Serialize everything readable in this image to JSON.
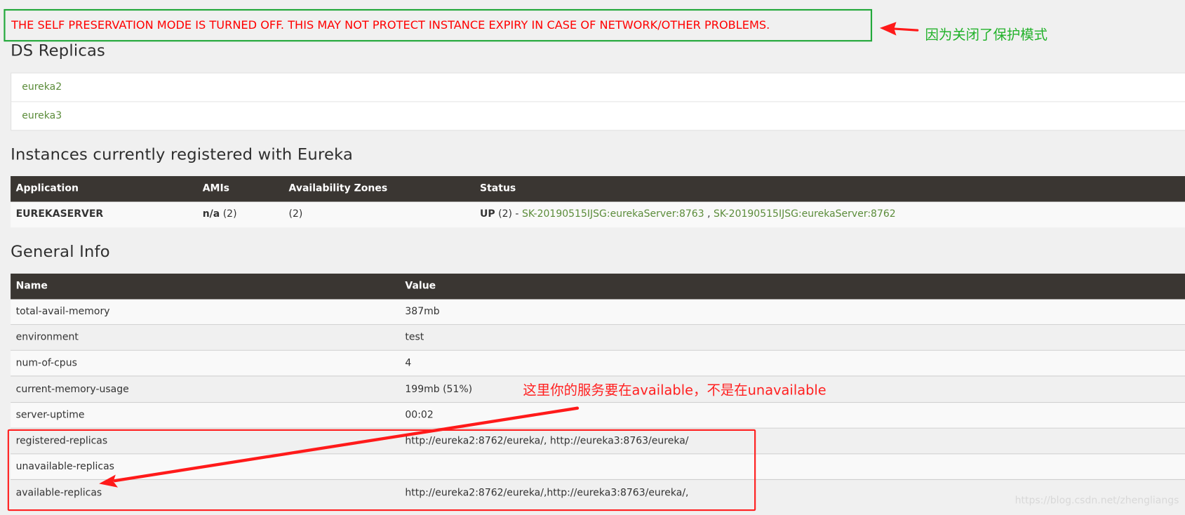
{
  "warning": {
    "text": "THE SELF PRESERVATION MODE IS TURNED OFF. THIS MAY NOT PROTECT INSTANCE EXPIRY IN CASE OF NETWORK/OTHER PROBLEMS."
  },
  "annotations": {
    "green_note": "因为关闭了保护模式",
    "red_note": "这里你的服务要在available，不是在unavailable"
  },
  "ds_replicas": {
    "title": "DS Replicas",
    "items": [
      "eureka2",
      "eureka3"
    ]
  },
  "instances": {
    "title": "Instances currently registered with Eureka",
    "headers": {
      "application": "Application",
      "amis": "AMIs",
      "zones": "Availability Zones",
      "status": "Status"
    },
    "row": {
      "application": "EUREKASERVER",
      "amis_bold": "n/a",
      "amis_count": "(2)",
      "zones": "(2)",
      "status_bold": "UP",
      "status_count": "(2) -",
      "link1": "SK-20190515IJSG:eurekaServer:8763",
      "separator": ",",
      "link2": "SK-20190515IJSG:eurekaServer:8762"
    }
  },
  "general_info": {
    "title": "General Info",
    "headers": {
      "name": "Name",
      "value": "Value"
    },
    "rows": [
      {
        "name": "total-avail-memory",
        "value": "387mb"
      },
      {
        "name": "environment",
        "value": "test"
      },
      {
        "name": "num-of-cpus",
        "value": "4"
      },
      {
        "name": "current-memory-usage",
        "value": "199mb (51%)"
      },
      {
        "name": "server-uptime",
        "value": "00:02"
      },
      {
        "name": "registered-replicas",
        "value": "http://eureka2:8762/eureka/, http://eureka3:8763/eureka/"
      },
      {
        "name": "unavailable-replicas",
        "value": ""
      },
      {
        "name": "available-replicas",
        "value": "http://eureka2:8762/eureka/,http://eureka3:8763/eureka/,"
      }
    ]
  },
  "watermark": "https://blog.csdn.net/zhengliangs",
  "colors": {
    "warning_red": "#ff0000",
    "annotation_green": "#22b22a",
    "annotation_red": "#ff2020",
    "table_header": "#3a3632",
    "link_green": "#5b8c3a"
  }
}
